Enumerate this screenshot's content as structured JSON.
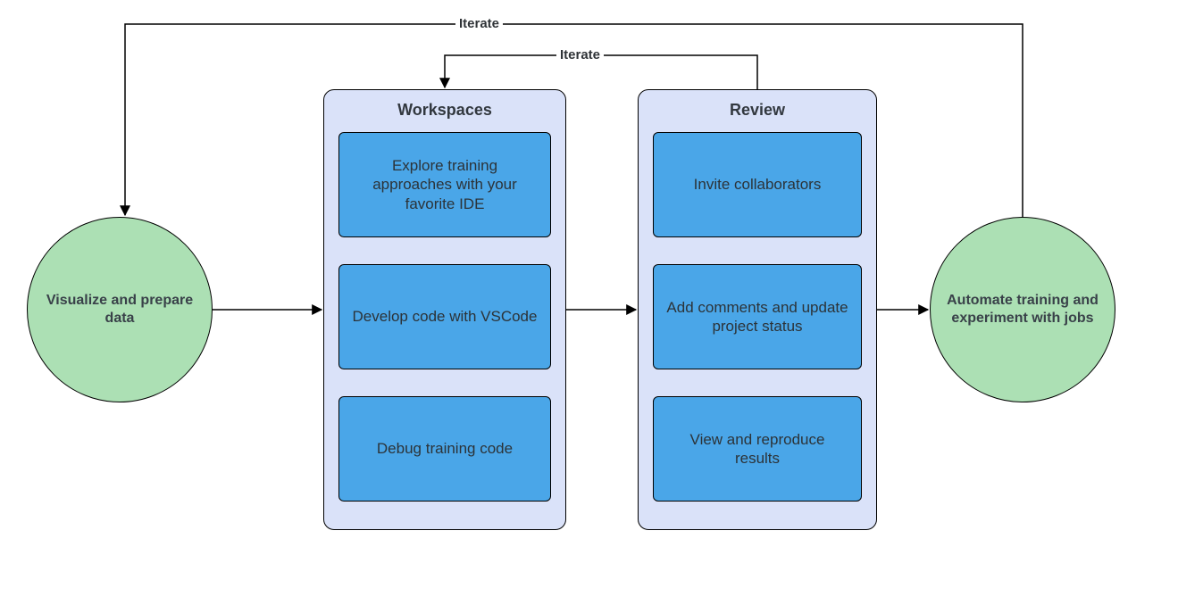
{
  "circles": {
    "left": "Visualize and prepare data",
    "right": "Automate training and experiment with jobs"
  },
  "panels": {
    "workspaces": {
      "title": "Workspaces",
      "cards": [
        "Explore training approaches with your favorite IDE",
        "Develop code with VSCode",
        "Debug training code"
      ]
    },
    "review": {
      "title": "Review",
      "cards": [
        "Invite collaborators",
        "Add comments and update project status",
        "View and reproduce results"
      ]
    }
  },
  "edges": {
    "iterate_top": "Iterate",
    "iterate_mid": "Iterate"
  }
}
